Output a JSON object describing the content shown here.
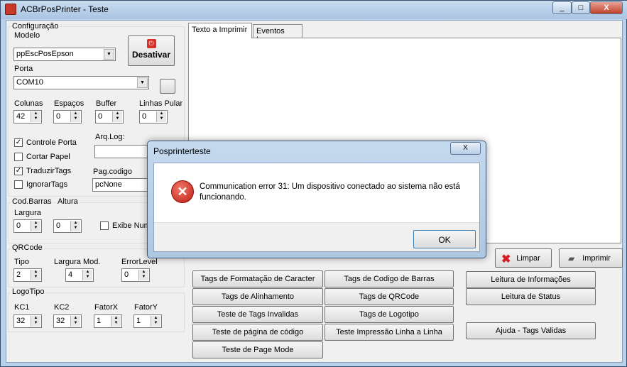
{
  "window": {
    "title": "ACBrPosPrinter - Teste",
    "minimize": "_",
    "maximize": "□",
    "close": "X"
  },
  "config": {
    "group_label": "Configuração",
    "modelo_label": "Modelo",
    "modelo_value": "ppEscPosEpson",
    "desativar": "Desativar",
    "porta_label": "Porta",
    "porta_value": "COM10",
    "colunas_label": "Colunas",
    "colunas_value": "42",
    "espacos_label": "Espaços",
    "espacos_value": "0",
    "buffer_label": "Buffer",
    "buffer_value": "0",
    "linhas_label": "Linhas Pular",
    "linhas_value": "0",
    "controle_porta": "Controle Porta",
    "cortar_papel": "Cortar Papel",
    "traduzir_tags": "TraduzirTags",
    "ignorar_tags": "IgnorarTags",
    "arqlog_label": "Arq.Log:",
    "arqlog_value": "",
    "pagcodigo_label": "Pag.codigo",
    "pagcodigo_value": "pcNone"
  },
  "codbarras": {
    "group_label": "Cod.Barras",
    "altura_label": "Altura",
    "altura_value": "0",
    "largura_label": "Largura",
    "largura_value": "0",
    "exibe_num": "Exibe Num"
  },
  "qrcode": {
    "group_label": "QRCode",
    "tipo_label": "Tipo",
    "tipo_value": "2",
    "largura_mod_label": "Largura Mod.",
    "largura_mod_value": "4",
    "error_label": "ErrorLevel",
    "error_value": "0"
  },
  "logotipo": {
    "group_label": "LogoTipo",
    "kc1_label": "KC1",
    "kc1_value": "32",
    "kc2_label": "KC2",
    "kc2_value": "32",
    "fatorx_label": "FatorX",
    "fatorx_value": "1",
    "fatory_label": "FatorY",
    "fatory_value": "1"
  },
  "tabs": [
    "Texto a Imprimir",
    "Eventos Log"
  ],
  "actions": {
    "limpar": "Limpar",
    "imprimir": "Imprimir"
  },
  "buttons": {
    "col1": [
      "Tags de Formatação de Caracter",
      "Tags de Alinhamento",
      "Teste de Tags Invalidas",
      "Teste de página de código",
      "Teste de Page Mode"
    ],
    "col2": [
      "Tags de Codigo de Barras",
      "Tags de QRCode",
      "Tags de Logotipo",
      "Teste Impressão Linha a Linha"
    ],
    "col3": [
      "Leitura de Informações",
      "Leitura de Status",
      "Ajuda - Tags Validas"
    ]
  },
  "dialog": {
    "title": "Posprinterteste",
    "close": "X",
    "message": "Communication error 31: Um dispositivo conectado ao sistema não está funcionando.",
    "ok": "OK",
    "icon": "error-icon"
  }
}
